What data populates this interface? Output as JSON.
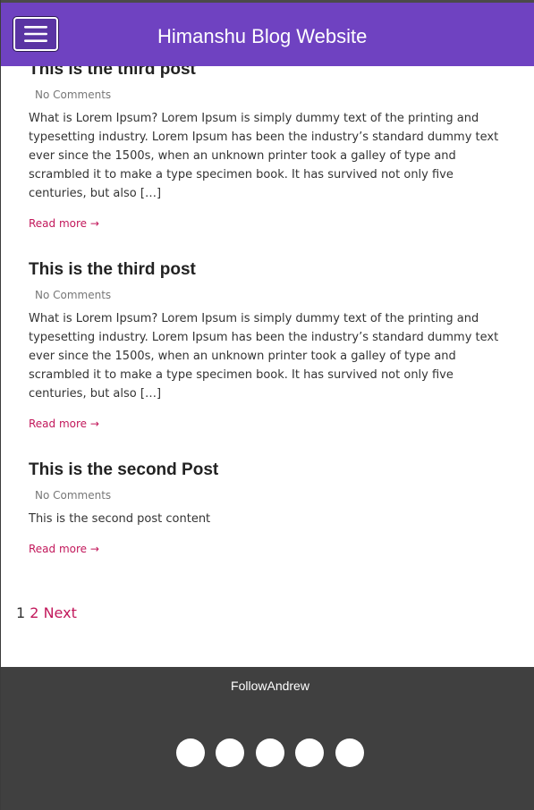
{
  "header": {
    "title": "Himanshu Blog Website",
    "menu_icon": "hamburger-icon"
  },
  "posts": [
    {
      "title": "This is the third post",
      "meta": "No Comments",
      "excerpt": "What is Lorem Ipsum? Lorem Ipsum is simply dummy text of the printing and typesetting industry. Lorem Ipsum has been the industry’s standard dummy text ever since the 1500s, when an unknown printer took a galley of type and scrambled it to make a type specimen book. It has survived not only five centuries, but also […]",
      "read_more": "Read more →"
    },
    {
      "title": "This is the third post",
      "meta": "No Comments",
      "excerpt": "What is Lorem Ipsum? Lorem Ipsum is simply dummy text of the printing and typesetting industry. Lorem Ipsum has been the industry’s standard dummy text ever since the 1500s, when an unknown printer took a galley of type and scrambled it to make a type specimen book. It has survived not only five centuries, but also […]",
      "read_more": "Read more →"
    },
    {
      "title": "This is the second Post",
      "meta": "No Comments",
      "excerpt": "This is the second post content",
      "read_more": "Read more →"
    }
  ],
  "pagination": {
    "current": "1",
    "page2": "2",
    "next": "Next"
  },
  "footer": {
    "follow_text": "FollowAndrew",
    "social_icons": [
      "social-icon-1",
      "social-icon-2",
      "social-icon-3",
      "social-icon-4",
      "social-icon-5"
    ]
  },
  "colors": {
    "header_bg": "#6f42c1",
    "link": "#c2185b",
    "footer_bg": "#404040"
  }
}
